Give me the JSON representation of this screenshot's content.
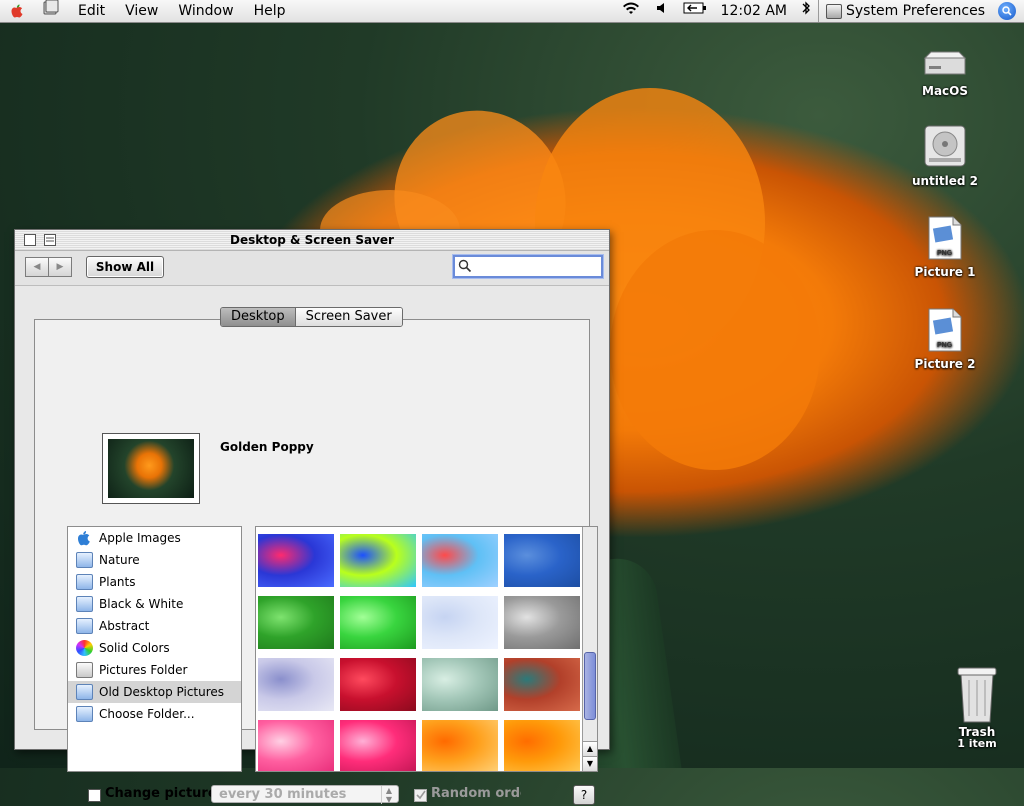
{
  "menubar": {
    "items": [
      "Edit",
      "View",
      "Window",
      "Help"
    ],
    "clock": "12:02 AM",
    "app_name": "System Preferences"
  },
  "desktop": {
    "icons": [
      {
        "label": "MacOS",
        "icon": "drive-icon"
      },
      {
        "label": "untitled 2",
        "icon": "hard-disk-icon"
      },
      {
        "label": "Picture 1",
        "icon": "png-file-icon"
      },
      {
        "label": "Picture 2",
        "icon": "png-file-icon"
      }
    ],
    "trash": {
      "label": "Trash",
      "count": "1 item"
    }
  },
  "window": {
    "title": "Desktop & Screen Saver",
    "show_all_label": "Show All",
    "search_value": "",
    "tabs": [
      {
        "label": "Desktop",
        "selected": true
      },
      {
        "label": "Screen Saver",
        "selected": false
      }
    ],
    "current_picture": "Golden Poppy",
    "sources": [
      {
        "label": "Apple Images",
        "icon": "apple-icon"
      },
      {
        "label": "Nature",
        "icon": "folder-icon"
      },
      {
        "label": "Plants",
        "icon": "folder-icon"
      },
      {
        "label": "Black & White",
        "icon": "folder-icon"
      },
      {
        "label": "Abstract",
        "icon": "folder-icon"
      },
      {
        "label": "Solid Colors",
        "icon": "color-wheel-icon"
      },
      {
        "label": "Pictures Folder",
        "icon": "pictures-folder-icon"
      },
      {
        "label": "Old Desktop Pictures",
        "icon": "folder-icon",
        "selected": true
      },
      {
        "label": "Choose Folder...",
        "icon": "folder-icon"
      }
    ],
    "thumbnails": [
      {
        "c1": "#2a37d6",
        "c2": "#ff2a6e",
        "c3": "#4a6bff"
      },
      {
        "c1": "#b9ff1c",
        "c2": "#1c50ff",
        "c3": "#2ec6ff"
      },
      {
        "c1": "#5fc0f5",
        "c2": "#ff4a4a",
        "c3": "#9fd0ff"
      },
      {
        "c1": "#2a63c9",
        "c2": "#5b8fdd",
        "c3": "#1d4ea3"
      },
      {
        "c1": "#2fa32a",
        "c2": "#7ee36f",
        "c3": "#1f7a1c"
      },
      {
        "c1": "#39d53f",
        "c2": "#a2ff97",
        "c3": "#1d9a1f"
      },
      {
        "c1": "#dde6f8",
        "c2": "#c6d4f2",
        "c3": "#eef3ff"
      },
      {
        "c1": "#9a9a9a",
        "c2": "#e2e2e2",
        "c3": "#6f6f6f"
      },
      {
        "c1": "#c9c9e8",
        "c2": "#8a8fcc",
        "c3": "#e8e8f5"
      },
      {
        "c1": "#c8102e",
        "c2": "#ff4a5e",
        "c3": "#8c0a1e"
      },
      {
        "c1": "#a3c7b8",
        "c2": "#d8eee3",
        "c3": "#6f9988"
      },
      {
        "c1": "#b2402a",
        "c2": "#2b7a7a",
        "c3": "#d66a4a"
      },
      {
        "c1": "#ff5fa0",
        "c2": "#ffd0e4",
        "c3": "#e82c79"
      },
      {
        "c1": "#ff2d7a",
        "c2": "#ffb0d6",
        "c3": "#c21654"
      },
      {
        "c1": "#ffa01c",
        "c2": "#ff6a00",
        "c3": "#ffd27a"
      },
      {
        "c1": "#ff9a0a",
        "c2": "#ff6d00",
        "c3": "#ffcb55"
      }
    ],
    "change_picture_label": "Change picture:",
    "change_picture_checked": false,
    "interval_value": "every 30 minutes",
    "random_order_label": "Random order",
    "random_order_checked": true,
    "help_label": "?"
  },
  "colors": {
    "accent": "#1558c9",
    "wallpaper_flower": "#f37a08",
    "wallpaper_dark": "#10241a"
  }
}
